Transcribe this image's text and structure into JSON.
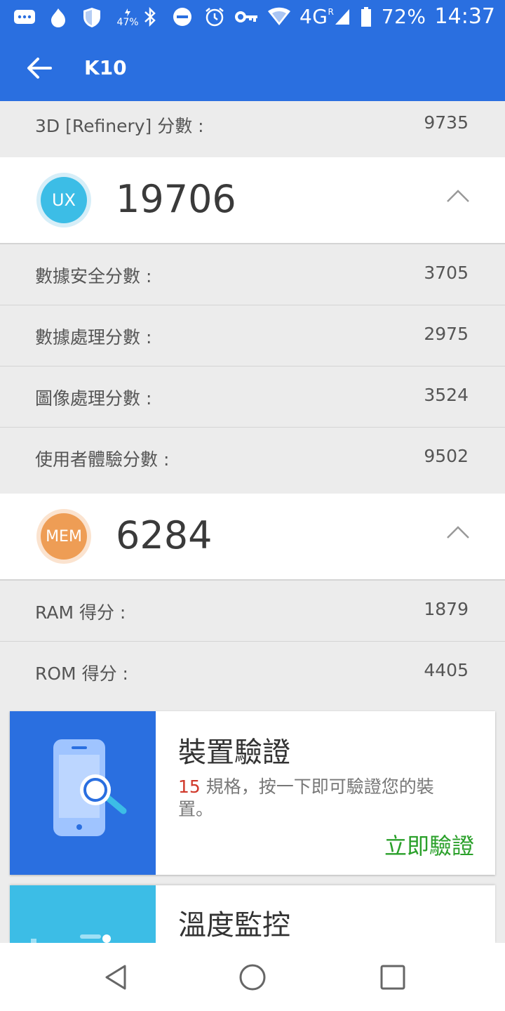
{
  "status_bar": {
    "battery_small": "47%",
    "network": "4G",
    "battery_percent": "72%",
    "time": "14:37"
  },
  "app_bar": {
    "title": "K10"
  },
  "top_row": {
    "label": "3D [Refinery] 分數 :",
    "value": "9735"
  },
  "ux_section": {
    "badge": "UX",
    "score": "19706",
    "rows": [
      {
        "label": "數據安全分數 :",
        "value": "3705"
      },
      {
        "label": "數據處理分數 :",
        "value": "2975"
      },
      {
        "label": "圖像處理分數 :",
        "value": "3524"
      },
      {
        "label": "使用者體驗分數 :",
        "value": "9502"
      }
    ]
  },
  "mem_section": {
    "badge": "MEM",
    "score": "6284",
    "rows": [
      {
        "label": "RAM 得分 :",
        "value": "1879"
      },
      {
        "label": "ROM 得分 :",
        "value": "4405"
      }
    ]
  },
  "card_verify": {
    "title": "裝置驗證",
    "count": "15",
    "desc": " 規格，按一下即可驗證您的裝置。",
    "action": "立即驗證"
  },
  "card_temp": {
    "title": "溫度監控"
  },
  "colors": {
    "primary": "#2a6fe0",
    "ux_badge": "#3cbde6",
    "mem_badge": "#ee9d55",
    "action_green": "#2aa02a",
    "highlight_red": "#d0392b"
  }
}
